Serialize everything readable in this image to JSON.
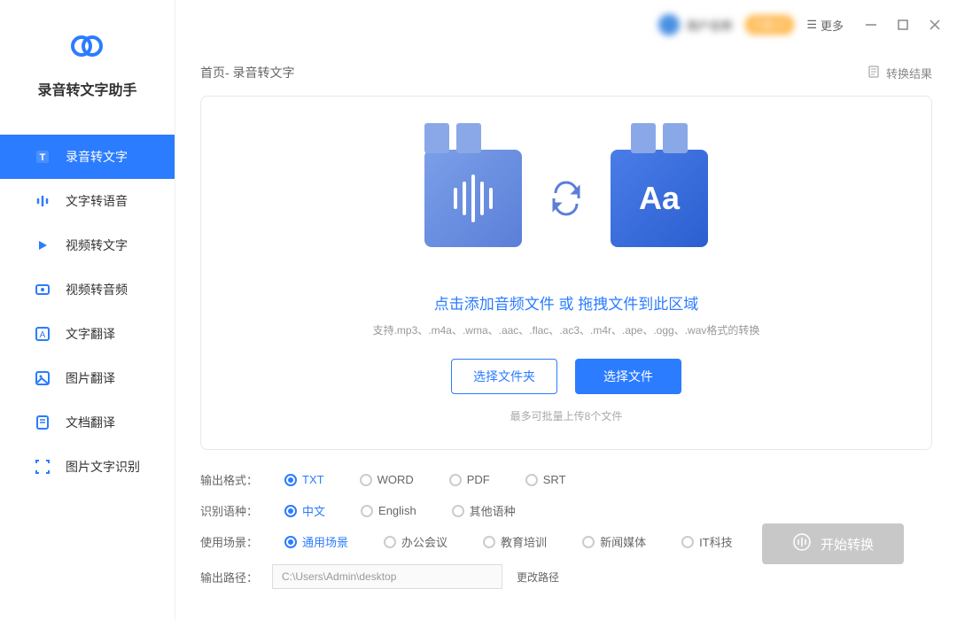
{
  "app": {
    "name": "录音转文字助手"
  },
  "sidebar": {
    "items": [
      {
        "label": "录音转文字",
        "icon": "text-icon",
        "active": true
      },
      {
        "label": "文字转语音",
        "icon": "voice-icon"
      },
      {
        "label": "视频转文字",
        "icon": "video-text-icon"
      },
      {
        "label": "视频转音频",
        "icon": "video-audio-icon"
      },
      {
        "label": "文字翻译",
        "icon": "text-translate-icon"
      },
      {
        "label": "图片翻译",
        "icon": "image-translate-icon"
      },
      {
        "label": "文档翻译",
        "icon": "doc-translate-icon"
      },
      {
        "label": "图片文字识别",
        "icon": "ocr-icon"
      }
    ]
  },
  "titlebar": {
    "user_name": "用户名称",
    "vip_label": "开通VIP",
    "more_label": "更多"
  },
  "breadcrumb": {
    "text": "首页- 录音转文字"
  },
  "result_link": "转换结果",
  "drop": {
    "title": "点击添加音频文件 或 拖拽文件到此区域",
    "formats": "支持.mp3、.m4a、.wma、.aac、.flac、.ac3、.m4r、.ape、.ogg、.wav格式的转换",
    "folder_btn": "选择文件夹",
    "file_btn": "选择文件",
    "limit": "最多可批量上传8个文件",
    "illu_text": "Aa"
  },
  "settings": {
    "format": {
      "label": "输出格式：",
      "options": [
        "TXT",
        "WORD",
        "PDF",
        "SRT"
      ],
      "selected": "TXT"
    },
    "language": {
      "label": "识别语种：",
      "options": [
        "中文",
        "English",
        "其他语种"
      ],
      "selected": "中文"
    },
    "scene": {
      "label": "使用场景：",
      "options": [
        "通用场景",
        "办公会议",
        "教育培训",
        "新闻媒体",
        "IT科技"
      ],
      "selected": "通用场景"
    },
    "output_path": {
      "label": "输出路径：",
      "value": "C:\\Users\\Admin\\desktop",
      "change_label": "更改路径"
    }
  },
  "start_btn": "开始转换"
}
